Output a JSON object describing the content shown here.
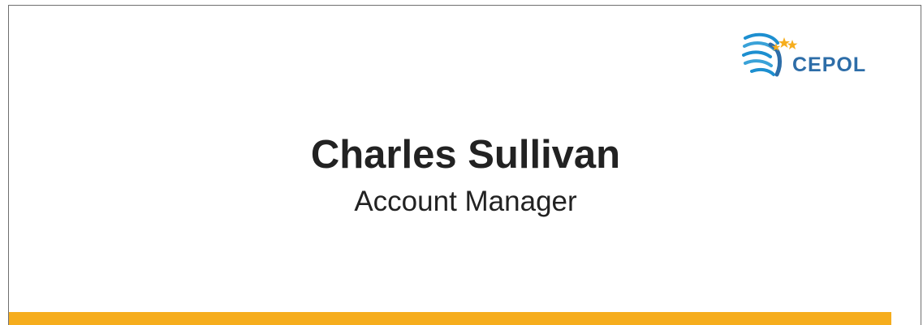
{
  "logo": {
    "text": "CEPOL",
    "icon": "cepol-swirl-stars-icon"
  },
  "person": {
    "name": "Charles Sullivan",
    "title": "Account Manager"
  },
  "colors": {
    "brand_blue": "#2d6da8",
    "accent_yellow": "#f6ad1d",
    "text_dark": "#222222"
  }
}
